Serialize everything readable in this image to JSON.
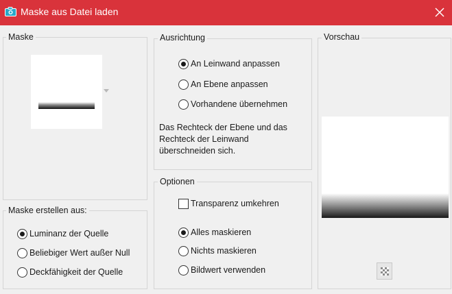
{
  "window": {
    "title": "Maske aus Datei laden",
    "accent": "#d9333b"
  },
  "maske": {
    "label": "Maske"
  },
  "erstellen": {
    "label": "Maske erstellen aus:",
    "options": [
      {
        "label": "Luminanz der Quelle",
        "checked": true
      },
      {
        "label": "Beliebiger Wert außer Null",
        "checked": false
      },
      {
        "label": "Deckfähigkeit der Quelle",
        "checked": false
      }
    ]
  },
  "ausrichtung": {
    "label": "Ausrichtung",
    "options": [
      {
        "label": "An Leinwand anpassen",
        "checked": true
      },
      {
        "label": "An Ebene anpassen",
        "checked": false
      },
      {
        "label": "Vorhandene übernehmen",
        "checked": false
      }
    ],
    "description": "Das Rechteck der Ebene und das Rechteck der Leinwand überschneiden sich."
  },
  "optionen": {
    "label": "Optionen",
    "transparenz_label": "Transparenz umkehren",
    "transparenz_checked": false,
    "options": [
      {
        "label": "Alles maskieren",
        "checked": true
      },
      {
        "label": "Nichts maskieren",
        "checked": false
      },
      {
        "label": "Bildwert verwenden",
        "checked": false
      }
    ]
  },
  "vorschau": {
    "label": "Vorschau"
  },
  "icons": {
    "title": "camera-icon",
    "close": "close-icon",
    "dropdown": "chevron-down-icon",
    "preview_toggle": "checkerboard-icon"
  }
}
